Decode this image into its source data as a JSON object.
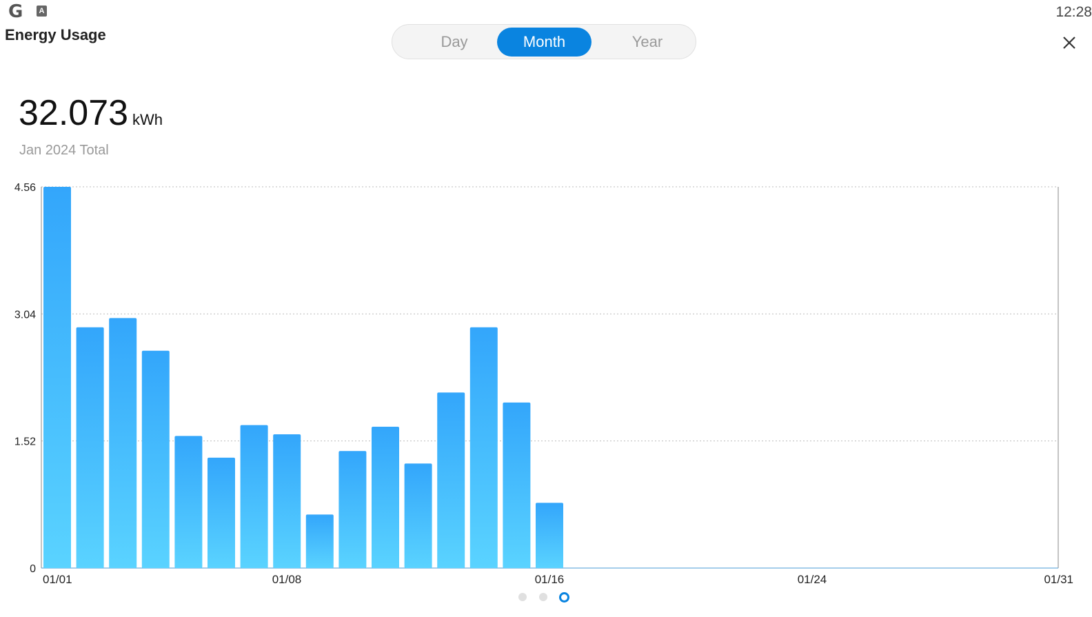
{
  "app": {
    "title": "Energy Usage",
    "clock": "12:28"
  },
  "status_icons": {
    "g_glyph": "G",
    "a_glyph": "A"
  },
  "tabs": [
    {
      "label": "Day",
      "active": false
    },
    {
      "label": "Month",
      "active": true
    },
    {
      "label": "Year",
      "active": false
    }
  ],
  "summary": {
    "value": "32.073",
    "unit": "kWh",
    "label": "Jan 2024 Total"
  },
  "pager": {
    "pages": 3,
    "current": 3
  },
  "colors": {
    "accent": "#0a84e0",
    "bar_top": "#33a6fb",
    "bar_bottom": "#5ad3ff",
    "grid": "#bbbbbb"
  },
  "chart_data": {
    "type": "bar",
    "x_start": 1,
    "x_end": 31,
    "categories": [
      "01/01",
      "01/02",
      "01/03",
      "01/04",
      "01/05",
      "01/06",
      "01/07",
      "01/08",
      "01/09",
      "01/10",
      "01/11",
      "01/12",
      "01/13",
      "01/14",
      "01/15",
      "01/16"
    ],
    "values": [
      4.56,
      2.88,
      2.99,
      2.6,
      1.58,
      1.32,
      1.71,
      1.6,
      0.64,
      1.4,
      1.69,
      1.25,
      2.1,
      2.88,
      1.98,
      0.78
    ],
    "x_tick_labels": [
      "01/01",
      "01/08",
      "01/16",
      "01/24",
      "01/31"
    ],
    "y_tick_labels": [
      "0",
      "1.52",
      "3.04",
      "4.56"
    ],
    "ylim": [
      0,
      4.56
    ],
    "grid": true,
    "xlabel": "",
    "ylabel": ""
  }
}
